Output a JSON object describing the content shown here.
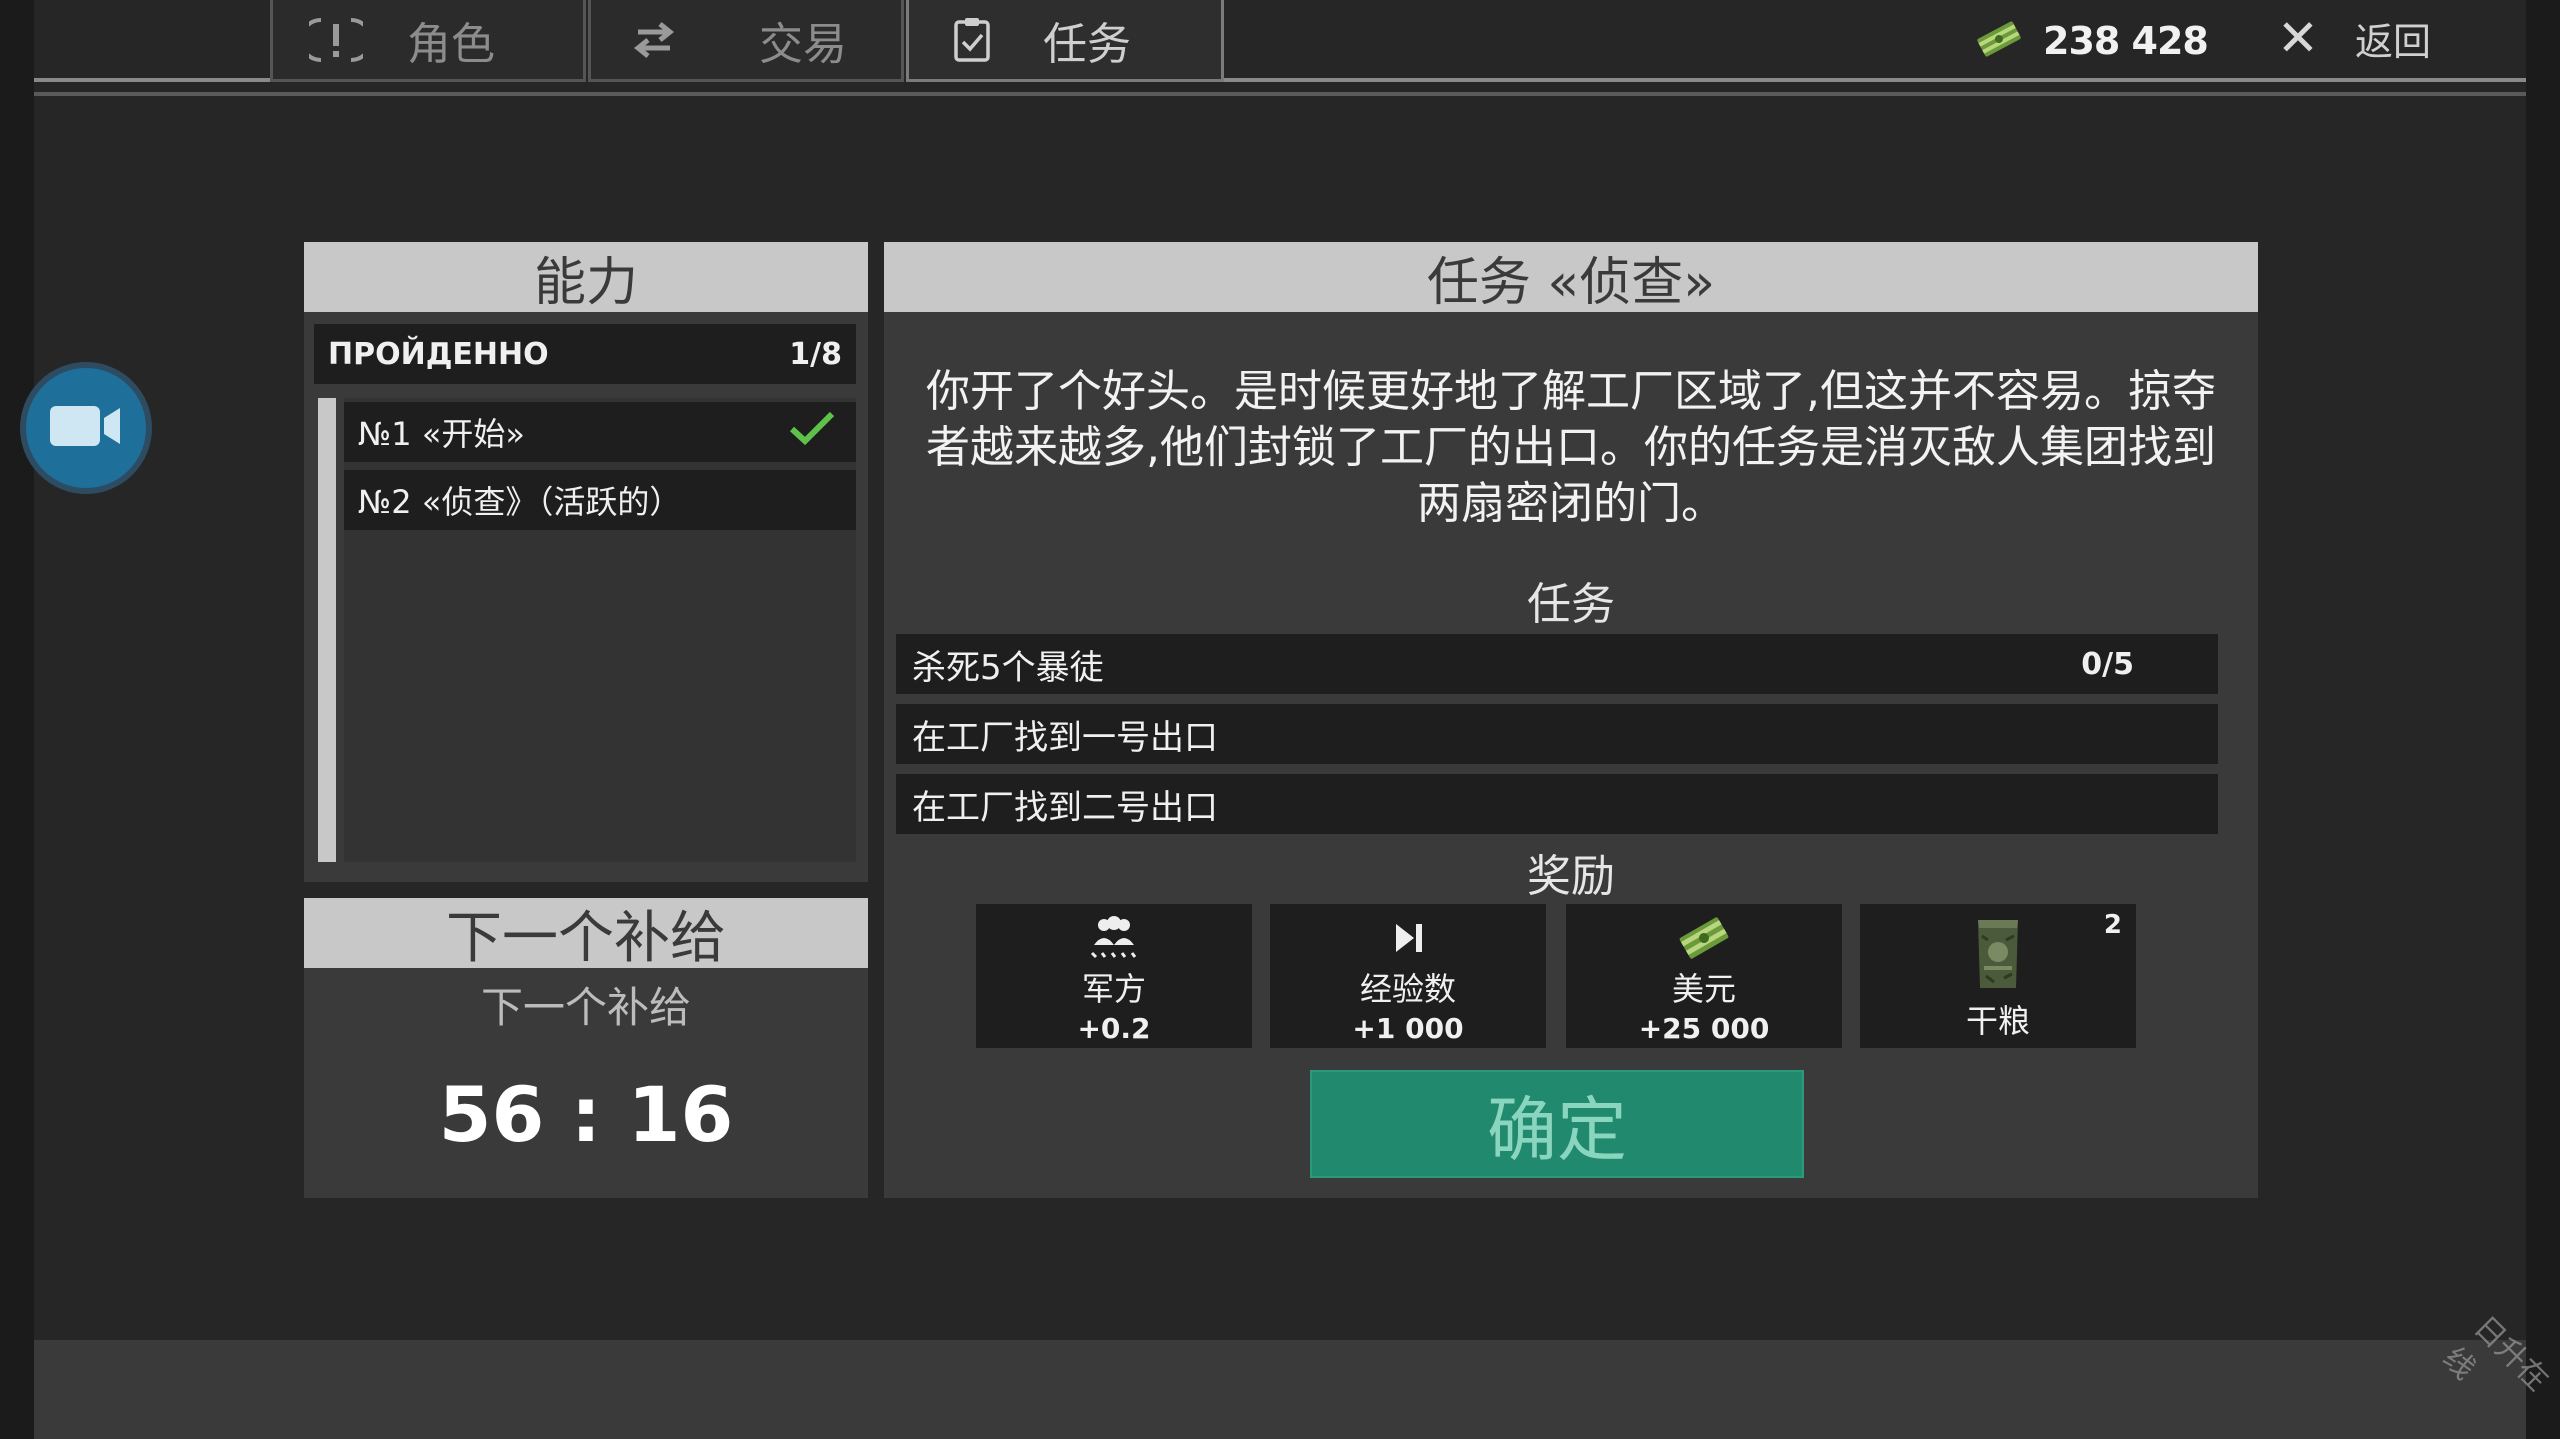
{
  "tabs": [
    {
      "label": "角色",
      "icon": "alert-icon"
    },
    {
      "label": "交易",
      "icon": "swap-icon"
    },
    {
      "label": "任务",
      "icon": "clipboard-check-icon"
    }
  ],
  "header": {
    "money": "238 428",
    "back_label": "返回"
  },
  "abilities": {
    "title": "能力",
    "passed_label": "ПРОЙДЕННО",
    "passed_count": "1/8",
    "quests": [
      {
        "label": "№1 «开始»",
        "done": true
      },
      {
        "label": "№2 «侦查》（活跃的）",
        "done": false
      }
    ]
  },
  "supply": {
    "title": "下一个补给",
    "subtitle": "下一个补给",
    "timer": "56 : 16"
  },
  "mission": {
    "title": "任务 «侦查»",
    "description": "你开了个好头。是时候更好地了解工厂区域了,但这并不容易。掠夺者越来越多,他们封锁了工厂的出口。你的任务是消灭敌人集团找到两扇密闭的门。",
    "tasks_title": "任务",
    "tasks": [
      {
        "label": "杀死5个暴徒",
        "progress": "0/5"
      },
      {
        "label": "在工厂找到一号出口",
        "progress": ""
      },
      {
        "label": "在工厂找到二号出口",
        "progress": ""
      }
    ],
    "rewards_title": "奖励",
    "rewards": [
      {
        "icon": "military-icon",
        "label": "军方",
        "value": "+0.2",
        "count": ""
      },
      {
        "icon": "experience-icon",
        "label": "经验数",
        "value": "+1 000",
        "count": ""
      },
      {
        "icon": "cash-icon",
        "label": "美元",
        "value": "+25 000",
        "count": ""
      },
      {
        "icon": "ration-pack-icon",
        "label": "干粮",
        "value": "",
        "count": "2"
      }
    ],
    "confirm_label": "确定"
  },
  "watermark": "日升在线",
  "colors": {
    "confirm_button": "#21896e",
    "camera_button": "#1e6f9a",
    "check": "#5ec24a"
  }
}
